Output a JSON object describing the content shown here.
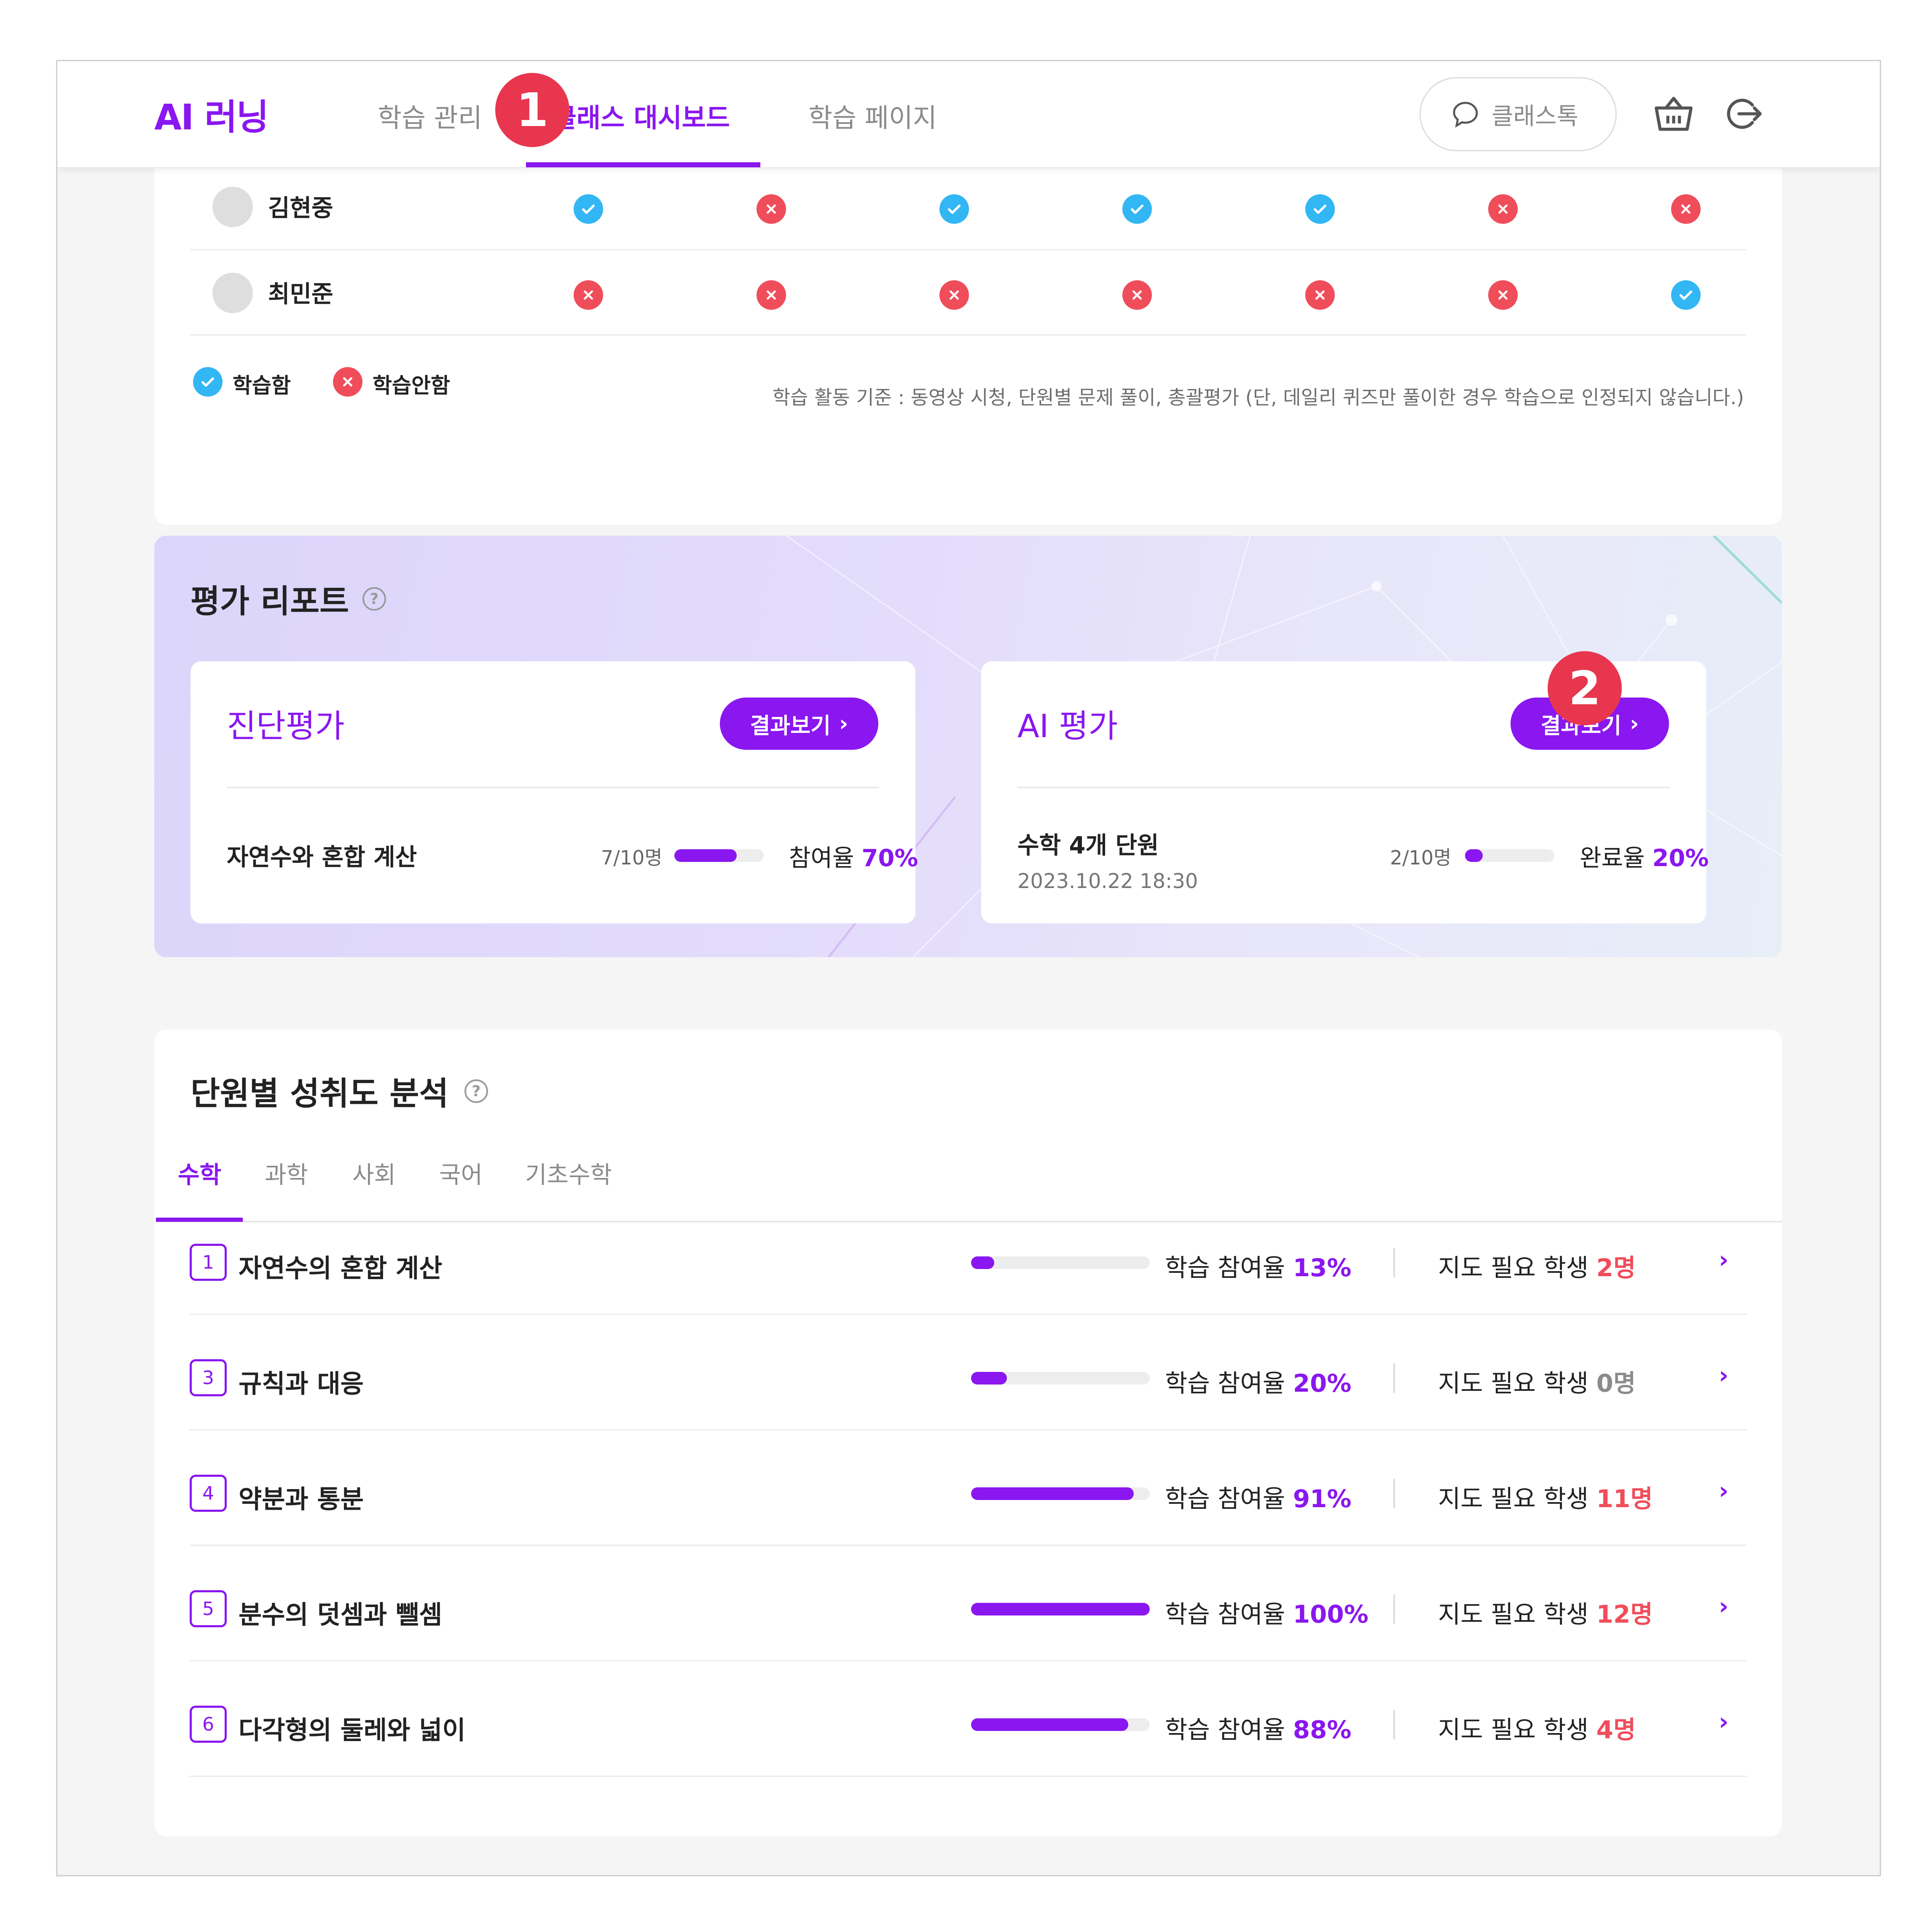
{
  "header": {
    "logo": "AI 러닝",
    "nav": [
      "학습 관리",
      "클래스 대시보드",
      "학습 페이지"
    ],
    "classtalk_label": "클래스톡",
    "badge1": "1",
    "badge2": "2"
  },
  "attendance": {
    "rows": [
      {
        "name": "김현중",
        "status": [
          "ok",
          "no",
          "ok",
          "ok",
          "ok",
          "no",
          "no"
        ]
      },
      {
        "name": "최민준",
        "status": [
          "no",
          "no",
          "no",
          "no",
          "no",
          "no",
          "ok"
        ]
      }
    ],
    "legend_done": "학습함",
    "legend_not": "학습안함",
    "criteria": "학습 활동 기준 : 동영상 시청, 단원별 문제 풀이, 총괄평가 (단, 데일리 퀴즈만 풀이한 경우 학습으로 인정되지 않습니다.)"
  },
  "report": {
    "title": "평가 리포트",
    "cards": [
      {
        "title": "진단평가",
        "button": "결과보기",
        "subject": "자연수와 혼합 계산",
        "date": "",
        "count": "7/10명",
        "progress": 0.7,
        "rate_label": "참여율",
        "rate_value": "70%"
      },
      {
        "title": "AI 평가",
        "button": "결과보기",
        "subject": "수학 4개 단원",
        "date": "2023.10.22 18:30",
        "count": "2/10명",
        "progress": 0.2,
        "rate_label": "완료율",
        "rate_value": "20%"
      }
    ]
  },
  "units": {
    "title": "단원별 성취도 분석",
    "tabs": [
      "수학",
      "과학",
      "사회",
      "국어",
      "기초수학"
    ],
    "participation_label": "학습 참여율",
    "need_label": "지도 필요 학생",
    "rows": [
      {
        "num": "1",
        "name": "자연수의 혼합 계산",
        "progress": 0.13,
        "rate": "13%",
        "need": "2명"
      },
      {
        "num": "3",
        "name": "규칙과 대응",
        "progress": 0.2,
        "rate": "20%",
        "need": "0명"
      },
      {
        "num": "4",
        "name": "약분과 통분",
        "progress": 0.91,
        "rate": "91%",
        "need": "11명"
      },
      {
        "num": "5",
        "name": "분수의 덧셈과 뺄셈",
        "progress": 1.0,
        "rate": "100%",
        "need": "12명"
      },
      {
        "num": "6",
        "name": "다각형의 둘레와 넓이",
        "progress": 0.88,
        "rate": "88%",
        "need": "4명"
      }
    ]
  },
  "colors": {
    "accent": "#8a16f0",
    "done": "#32b6f4",
    "not_done": "#f04d5b",
    "badge": "#e8364f"
  }
}
